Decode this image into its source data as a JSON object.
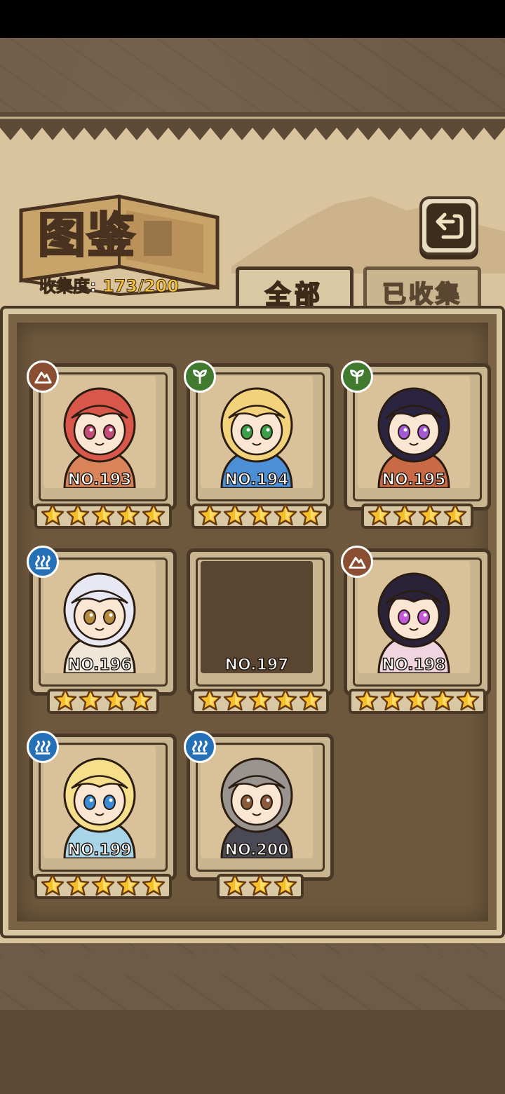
{
  "header": {
    "title": "图鉴",
    "collection_label": "收集度:",
    "collection_value": "173/200"
  },
  "tabs": [
    {
      "label": "全部",
      "active": true
    },
    {
      "label": "已收集",
      "active": false
    }
  ],
  "cards": [
    {
      "number": "NO.193",
      "stars": 5,
      "element": "earth",
      "hair": "#d9564a",
      "eyes": "#c44a7a",
      "outfit": "#d9835a",
      "bg": "#d9c19a"
    },
    {
      "number": "NO.194",
      "stars": 5,
      "element": "leaf",
      "hair": "#f2d27a",
      "eyes": "#3aa04a",
      "outfit": "#4d8fd6",
      "bg": "#d9c19a"
    },
    {
      "number": "NO.195",
      "stars": 4,
      "element": "leaf",
      "hair": "#2b2440",
      "eyes": "#a45ad6",
      "outfit": "#c96a46",
      "bg": "#d9c19a"
    },
    {
      "number": "NO.196",
      "stars": 4,
      "element": "water",
      "hair": "#e8e8f4",
      "eyes": "#b48a3c",
      "outfit": "#efe6d8",
      "bg": "#d9c19a"
    },
    {
      "number": "NO.197",
      "stars": 5,
      "element": "",
      "hair": "",
      "eyes": "",
      "outfit": "",
      "bg": ""
    },
    {
      "number": "NO.198",
      "stars": 5,
      "element": "earth",
      "hair": "#2a2238",
      "eyes": "#c45ad6",
      "outfit": "#f0d4e0",
      "bg": "#d9c19a"
    },
    {
      "number": "NO.199",
      "stars": 5,
      "element": "water",
      "hair": "#f5df8a",
      "eyes": "#3a8ad6",
      "outfit": "#a8d4e8",
      "bg": "#d9c19a"
    },
    {
      "number": "NO.200",
      "stars": 3,
      "element": "water",
      "hair": "#9a9490",
      "eyes": "#8a5a3a",
      "outfit": "#4a4a56",
      "bg": "#d9c19a"
    }
  ]
}
